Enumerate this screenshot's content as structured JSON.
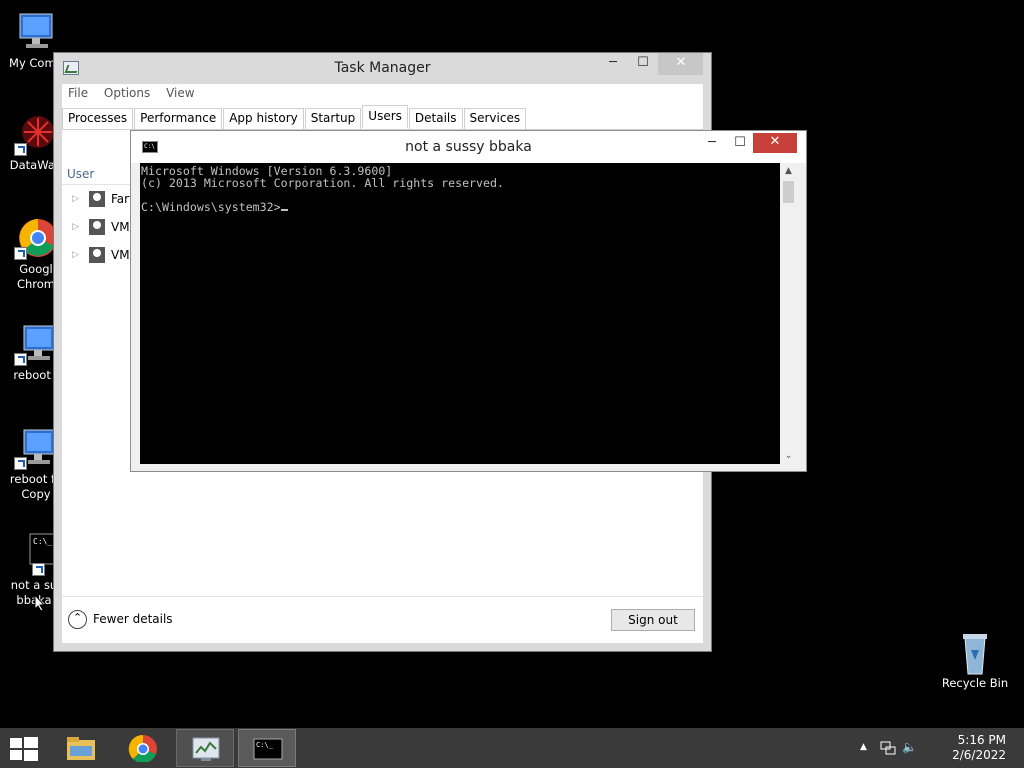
{
  "desktop": {
    "icons": [
      {
        "label": "My Comp",
        "icon": "computer-icon"
      },
      {
        "label": "DataWag",
        "icon": "datawag-icon"
      },
      {
        "label": "Googl Chrom",
        "icon": "chrome-icon"
      },
      {
        "label": "reboot f",
        "icon": "computer-icon"
      },
      {
        "label": "reboot fa Copy",
        "icon": "computer-icon"
      },
      {
        "label": "not a su bbaka",
        "icon": "cmd-icon"
      },
      {
        "label": "Recycle Bin",
        "icon": "recycle-bin-icon"
      }
    ]
  },
  "task_manager": {
    "title": "Task Manager",
    "menu": [
      "File",
      "Options",
      "View"
    ],
    "tabs": [
      "Processes",
      "Performance",
      "App history",
      "Startup",
      "Users",
      "Details",
      "Services"
    ],
    "active_tab": "Users",
    "column_header": "User",
    "users": [
      "Fart",
      "VM",
      "VM"
    ],
    "fewer_details": "Fewer details",
    "sign_out": "Sign out"
  },
  "cmd": {
    "title": "not a sussy bbaka",
    "lines": [
      "Microsoft Windows [Version 6.3.9600]",
      "(c) 2013 Microsoft Corporation. All rights reserved.",
      "",
      "C:\\Windows\\system32>"
    ]
  },
  "taskbar": {
    "items": [
      "file-explorer-icon",
      "chrome-icon",
      "task-manager-icon",
      "cmd-icon"
    ],
    "active_item": "cmd-icon",
    "time": "5:16 PM",
    "date": "2/6/2022"
  },
  "colors": {
    "desktop": "#000000",
    "taskbar": "#3a3a3a",
    "close_button": "#c7403a",
    "console_text": "#c0c0c0"
  }
}
